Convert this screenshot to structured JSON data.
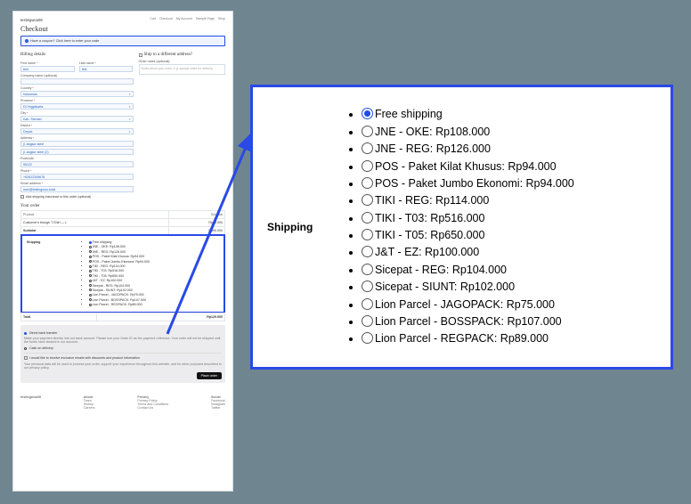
{
  "site_title": "testingwoo08",
  "nav": {
    "cart": "Cart",
    "checkout": "Checkout",
    "account": "My Account",
    "sample": "Sample Page",
    "shop": "Shop"
  },
  "page_title": "Checkout",
  "coupon_notice": {
    "icon": "i",
    "text": "Have a coupon? Click here to enter your code"
  },
  "billing": {
    "heading": "Billing details",
    "first_name": {
      "label": "First name",
      "value": "test"
    },
    "last_name": {
      "label": "Last name",
      "value": "test"
    },
    "company": {
      "label": "Company name (optional)"
    },
    "country": {
      "label": "Country",
      "value": "Indonesia"
    },
    "province": {
      "label": "Province",
      "value": "DI Yogyakarta"
    },
    "city": {
      "label": "City",
      "value": "Kab. Sleman"
    },
    "district": {
      "label": "District",
      "value": "Depok"
    },
    "address1": {
      "label": "Address",
      "value": "jl. angkor steel"
    },
    "address2": {
      "value": "jl. angkor steel (2)"
    },
    "postcode": {
      "label": "Postcode",
      "value": "55122"
    },
    "phone": {
      "label": "Phone",
      "value": "+62812345678"
    },
    "email": {
      "label": "Email address",
      "value": "user@testingwoo.local"
    },
    "insurance_checkbox": "Add shipping insurance to this order (optional)"
  },
  "ship_diff": {
    "heading": "Ship to a different address?",
    "notes_label": "Order notes (optional)",
    "notes_placeholder": "Notes about your order, e.g. special notes for delivery."
  },
  "order": {
    "heading": "Your order",
    "cols": {
      "product": "Product",
      "subtotal": "Subtotal"
    },
    "line": {
      "name": "Customer's though T-Shirt — L",
      "price": "Rp90.000"
    },
    "subtotal": {
      "label": "Subtotal",
      "value": "Rp90.000"
    },
    "shipping_label": "Shipping",
    "total": {
      "label": "Total",
      "value": "Rp129.500"
    }
  },
  "shipping_options": [
    {
      "label": "Free shipping",
      "selected": true
    },
    {
      "label": "JNE - OKE: Rp108.000"
    },
    {
      "label": "JNE - REG: Rp126.000"
    },
    {
      "label": "POS - Paket Kilat Khusus: Rp94.000"
    },
    {
      "label": "POS - Paket Jumbo Ekonomi: Rp94.000"
    },
    {
      "label": "TIKI - REG: Rp114.000"
    },
    {
      "label": "TIKI - T03: Rp516.000"
    },
    {
      "label": "TIKI - T05: Rp650.000"
    },
    {
      "label": "J&T - EZ: Rp100.000"
    },
    {
      "label": "Sicepat - REG: Rp104.000"
    },
    {
      "label": "Sicepat - SIUNT: Rp102.000"
    },
    {
      "label": "Lion Parcel - JAGOPACK: Rp75.000"
    },
    {
      "label": "Lion Parcel - BOSSPACK: Rp107.000"
    },
    {
      "label": "Lion Parcel - REGPACK: Rp89.000"
    }
  ],
  "payment": {
    "method": "Direct bank transfer",
    "desc": "Make your payment directly into our bank account. Please use your Order ID as the payment reference. Your order will not be shipped until the funds have cleared in our account.",
    "cod": "Cash on delivery",
    "mailing": "I would like to receive exclusive emails with discounts and product information",
    "privacy": "Your personal data will be used to process your order, support your experience throughout this website, and for other purposes described in our privacy policy.",
    "button": "Place order"
  },
  "footer": {
    "brand": "testingwoo08",
    "about": {
      "h": "About",
      "a": "Team",
      "b": "History",
      "c": "Careers"
    },
    "privacy": {
      "h": "Privacy",
      "a": "Privacy Policy",
      "b": "Terms and Conditions",
      "c": "Contact Us"
    },
    "social": {
      "h": "Social",
      "a": "Facebook",
      "b": "Instagram",
      "c": "Twitter"
    }
  },
  "callout_label": "Shipping"
}
